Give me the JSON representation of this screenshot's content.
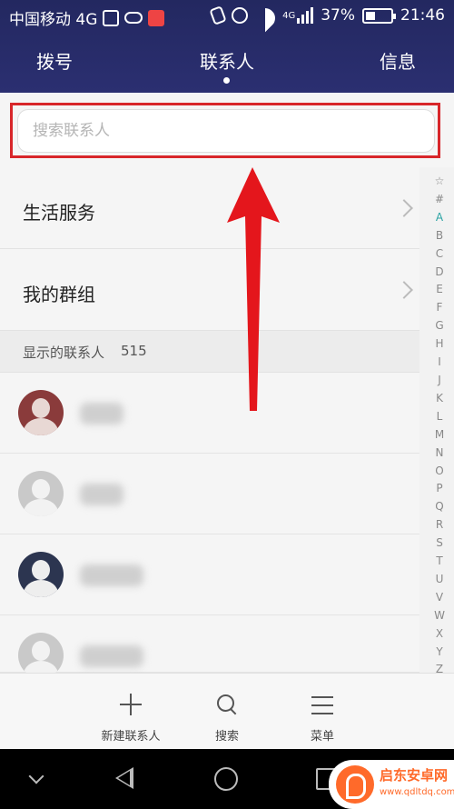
{
  "status_bar": {
    "carrier": "中国移动 4G",
    "network_badge": "4G",
    "battery": "37%",
    "time": "21:46"
  },
  "tabs": [
    {
      "label": "拨号"
    },
    {
      "label": "联系人"
    },
    {
      "label": "信息"
    }
  ],
  "search": {
    "placeholder": "搜索联系人"
  },
  "groups": [
    {
      "label": "生活服务"
    },
    {
      "label": "我的群组"
    }
  ],
  "contacts_section": {
    "label": "显示的联系人",
    "count": "515"
  },
  "alphabet_index": [
    "☆",
    "#",
    "A",
    "B",
    "C",
    "D",
    "E",
    "F",
    "G",
    "H",
    "I",
    "J",
    "K",
    "L",
    "M",
    "N",
    "O",
    "P",
    "Q",
    "R",
    "S",
    "T",
    "U",
    "V",
    "W",
    "X",
    "Y",
    "Z"
  ],
  "alphabet_active": "A",
  "toolbar": {
    "new_contact": "新建联系人",
    "search": "搜索",
    "menu": "菜单"
  },
  "watermark": {
    "title": "启东安卓网",
    "url": "www.qdltdq.com"
  },
  "colors": {
    "header_bg": "#2b2f71",
    "highlight_red": "#d8262a",
    "index_active": "#2aa3a3"
  }
}
